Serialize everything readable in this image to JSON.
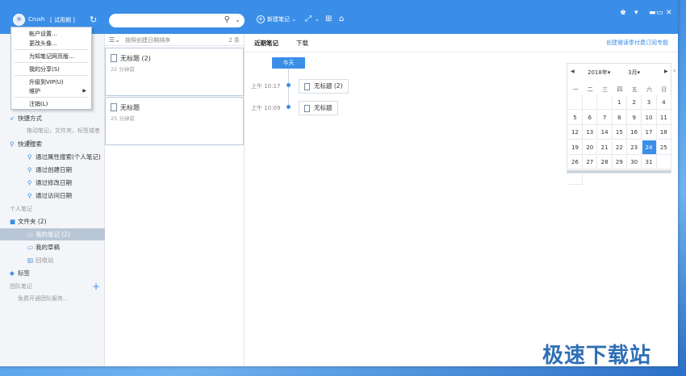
{
  "header": {
    "username": "Crush",
    "trial": "[ 试用期 ]",
    "new_note": "新建笔记",
    "window_controls": [
      "shirt-icon",
      "signal-icon",
      "minimize-icon",
      "maximize-icon",
      "close-icon"
    ]
  },
  "account_menu": {
    "items": [
      "帐户设置...",
      "更改头像...",
      "为知笔记网页版...",
      "我的分享(S)",
      "升级到VIP(U)",
      "维护",
      "注销(L)"
    ]
  },
  "sidebar": {
    "shortcuts": "快捷方式",
    "shortcut_hint": "拖动笔记，文件夹，标签或者群",
    "quick_search": "快速搜索",
    "search_items": [
      "通过属性搜索(个人笔记)",
      "通过创建日期",
      "通过修改日期",
      "通过访问日期"
    ],
    "personal": "个人笔记",
    "folder": "文件夹 (2)",
    "my_notes": "我的笔记 (2)",
    "drafts": "我的草稿",
    "recycle": "回收站",
    "tags": "标签",
    "team": "团队笔记",
    "team_hint": "免费开通团队服务..."
  },
  "note_list": {
    "sort": "按照创建日期排序",
    "count": "2 条",
    "cards": [
      {
        "title": "无标题 (2)",
        "sub": "22 分钟前"
      },
      {
        "title": "无标题",
        "sub": "25 分钟前"
      }
    ]
  },
  "main": {
    "tabs": [
      "近期笔记",
      "下载"
    ],
    "subscribe": "创建微读季付费订阅专题",
    "today": "今天",
    "timeline": [
      {
        "time": "上午 10:17",
        "title": "无标题 (2)"
      },
      {
        "time": "上午 10:09",
        "title": "无标题"
      }
    ]
  },
  "calendar": {
    "year": "2018年",
    "month": "3月",
    "weekdays": [
      "一",
      "二",
      "三",
      "四",
      "五",
      "六",
      "日"
    ],
    "days": [
      "",
      "",
      "",
      "1",
      "2",
      "3",
      "4",
      "5",
      "6",
      "7",
      "8",
      "9",
      "10",
      "11",
      "12",
      "13",
      "14",
      "15",
      "16",
      "17",
      "18",
      "19",
      "20",
      "21",
      "22",
      "23",
      "24",
      "25",
      "26",
      "27",
      "28",
      "29",
      "30",
      "31",
      "",
      ""
    ],
    "selected": "24"
  },
  "watermark": "极速下载站",
  "colors": {
    "accent": "#3a8ee8",
    "selected_row": "#b9c6d6"
  }
}
